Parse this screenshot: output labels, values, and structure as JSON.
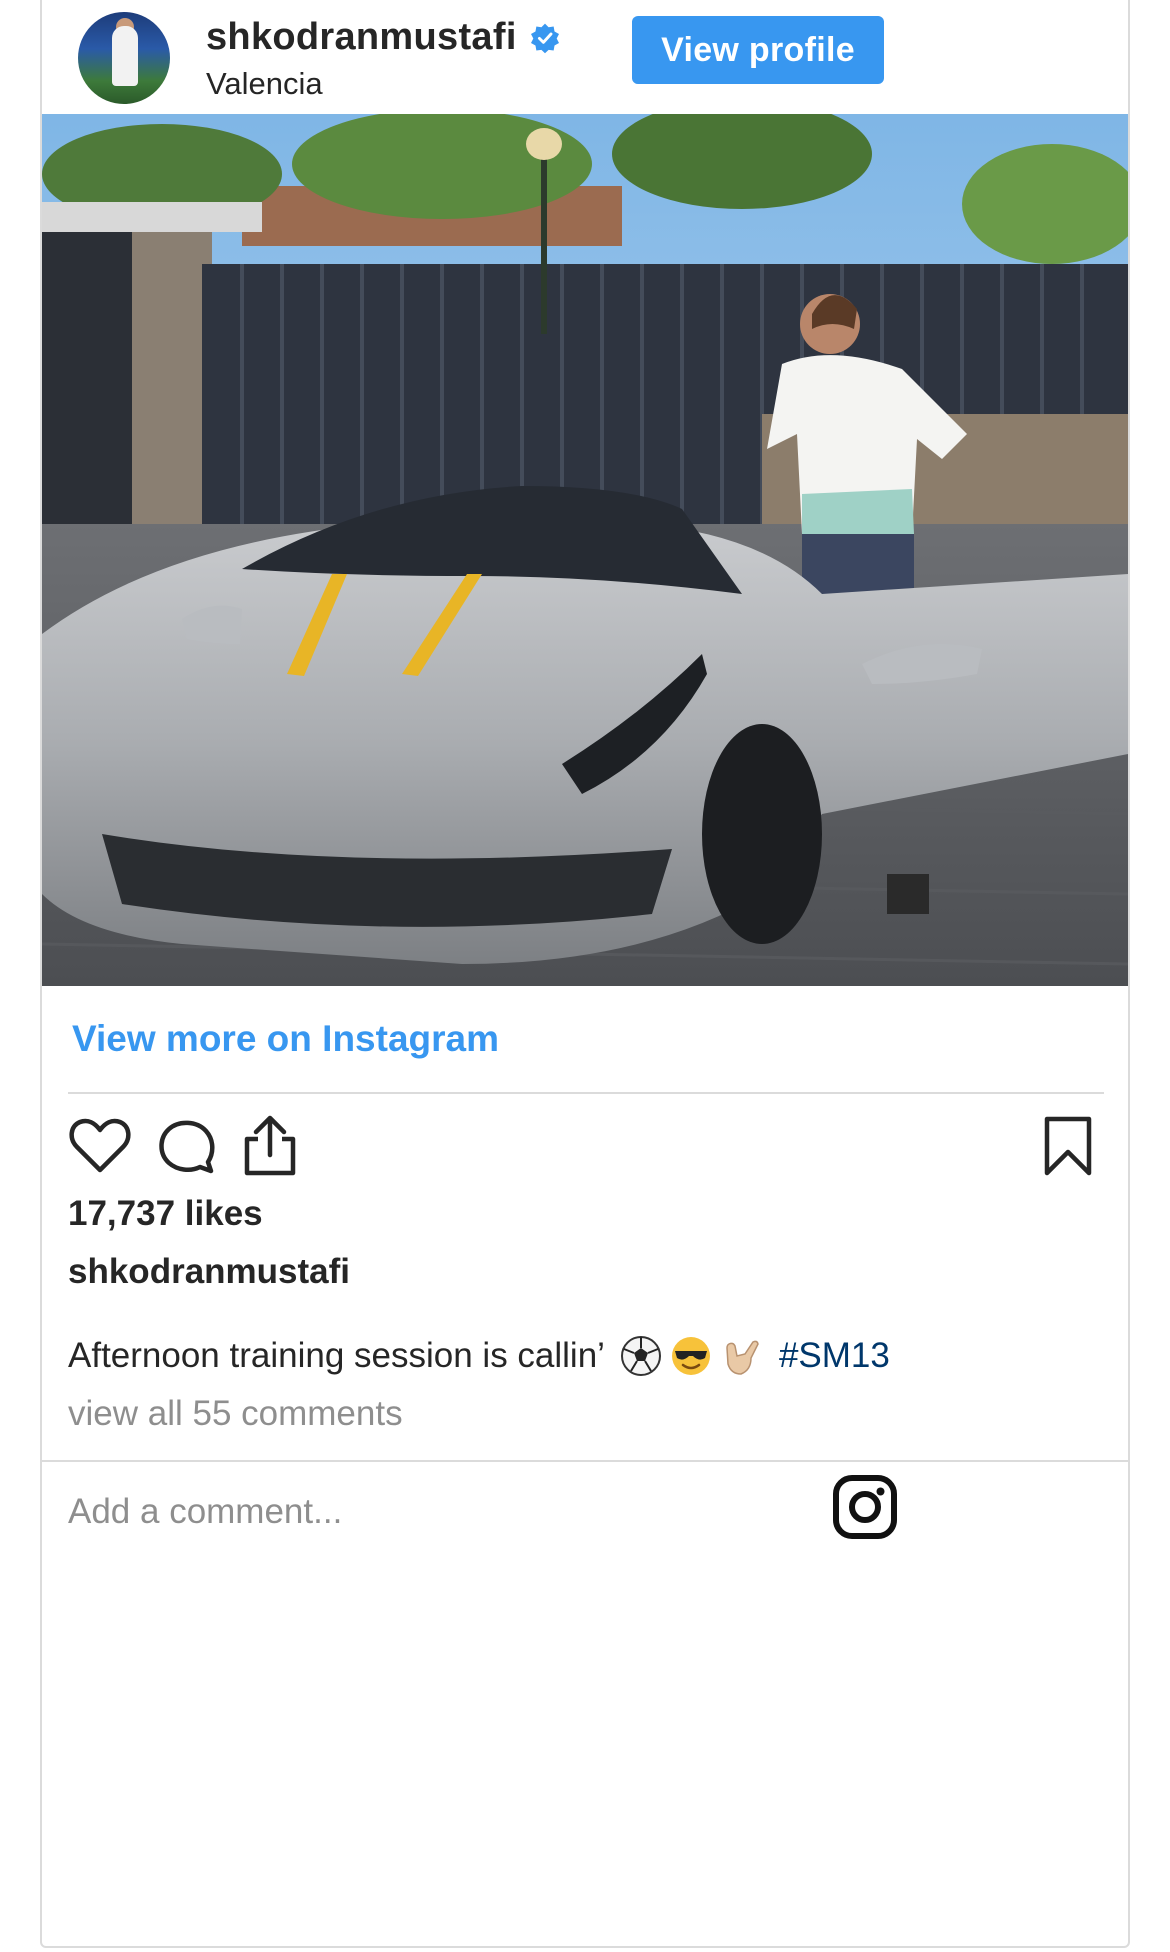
{
  "post": {
    "username": "shkodranmustafi",
    "location": "Valencia",
    "view_profile_label": "View profile",
    "view_more_label": "View more on Instagram",
    "likes_text": "17,737 likes",
    "caption_user": "shkodranmustafi",
    "caption_text": "Afternoon training session is callin’",
    "caption_hashtag": "#SM13",
    "view_comments_label": "view all 55 comments",
    "comment_placeholder": "Add a comment..."
  },
  "icons": {
    "verified": "verified-badge-icon",
    "like": "heart-icon",
    "comment": "speech-bubble-icon",
    "share": "share-icon",
    "save": "bookmark-icon",
    "logo": "instagram-logo-icon",
    "emojis": [
      "soccer-ball-emoji",
      "sunglasses-face-emoji",
      "call-me-hand-emoji"
    ]
  },
  "colors": {
    "accent": "#3897f0",
    "text": "#262626",
    "muted": "#8e8e8e",
    "border": "#dbdbdb",
    "hashtag": "#00376b"
  }
}
